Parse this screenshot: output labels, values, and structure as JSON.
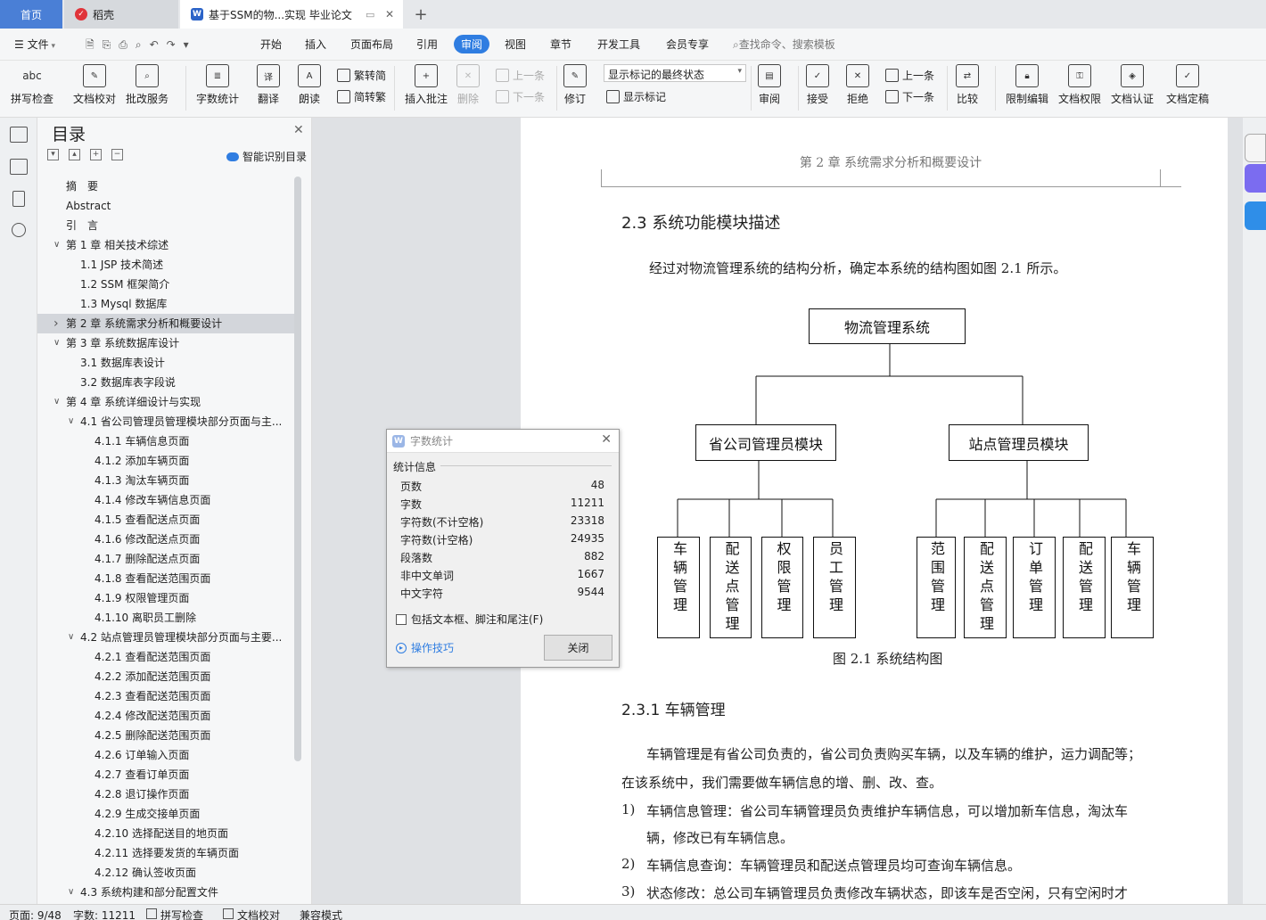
{
  "tabs": {
    "home": "首页",
    "daoke": "稻壳",
    "doc": "基于SSM的物...实现 毕业论文",
    "new_tab": "+"
  },
  "menu": {
    "file": "文件",
    "items": [
      "开始",
      "插入",
      "页面布局",
      "引用",
      "审阅",
      "视图",
      "章节",
      "开发工具",
      "会员专享"
    ],
    "search": "查找命令、搜索模板"
  },
  "ribbon": {
    "spellcheck": "拼写检查",
    "doc_proof": "文档校对",
    "batch_service": "批改服务",
    "wordcount": "字数统计",
    "translate": "翻译",
    "read_aloud": "朗读",
    "trad": "繁转简",
    "simp": "简转繁",
    "insert_comment": "插入批注",
    "delete": "删除",
    "prev_comment": "上一条",
    "next_comment": "下一条",
    "track": "修订",
    "markup_select": "显示标记的最终状态",
    "show_markup": "显示标记",
    "review": "审阅",
    "accept": "接受",
    "reject": "拒绝",
    "prev": "上一条",
    "next": "下一条",
    "compare": "比较",
    "restrict": "限制编辑",
    "permission": "文档权限",
    "certify": "文档认证",
    "finalize": "文档定稿"
  },
  "toc": {
    "title": "目录",
    "smart": "智能识别目录",
    "items": [
      {
        "text": "摘　要",
        "level": 0,
        "arrow": ""
      },
      {
        "text": "Abstract",
        "level": 0,
        "arrow": ""
      },
      {
        "text": "引　言",
        "level": 0,
        "arrow": ""
      },
      {
        "text": "第 1 章  相关技术综述",
        "level": 0,
        "arrow": "down"
      },
      {
        "text": "1.1 JSP 技术简述",
        "level": 1,
        "arrow": ""
      },
      {
        "text": "1.2 SSM 框架简介",
        "level": 1,
        "arrow": ""
      },
      {
        "text": "1.3 Mysql 数据库",
        "level": 1,
        "arrow": ""
      },
      {
        "text": "第 2 章  系统需求分析和概要设计",
        "level": 0,
        "arrow": "right",
        "selected": true
      },
      {
        "text": "第 3 章  系统数据库设计",
        "level": 0,
        "arrow": "down"
      },
      {
        "text": "3.1  数据库表设计",
        "level": 1,
        "arrow": ""
      },
      {
        "text": "3.2  数据库表字段说",
        "level": 1,
        "arrow": ""
      },
      {
        "text": "第 4 章  系统详细设计与实现",
        "level": 0,
        "arrow": "down"
      },
      {
        "text": "4.1  省公司管理员管理模块部分页面与主...",
        "level": 1,
        "arrow": "down"
      },
      {
        "text": "4.1.1 车辆信息页面",
        "level": 2,
        "arrow": ""
      },
      {
        "text": "4.1.2 添加车辆页面",
        "level": 2,
        "arrow": ""
      },
      {
        "text": "4.1.3 淘汰车辆页面",
        "level": 2,
        "arrow": ""
      },
      {
        "text": "4.1.4 修改车辆信息页面",
        "level": 2,
        "arrow": ""
      },
      {
        "text": "4.1.5 查看配送点页面",
        "level": 2,
        "arrow": ""
      },
      {
        "text": "4.1.6 修改配送点页面",
        "level": 2,
        "arrow": ""
      },
      {
        "text": "4.1.7 删除配送点页面",
        "level": 2,
        "arrow": ""
      },
      {
        "text": "4.1.8 查看配送范围页面",
        "level": 2,
        "arrow": ""
      },
      {
        "text": "4.1.9 权限管理页面",
        "level": 2,
        "arrow": ""
      },
      {
        "text": "4.1.10 离职员工删除",
        "level": 2,
        "arrow": ""
      },
      {
        "text": "4.2 站点管理员管理模块部分页面与主要...",
        "level": 1,
        "arrow": "down"
      },
      {
        "text": "4.2.1 查看配送范围页面",
        "level": 2,
        "arrow": ""
      },
      {
        "text": "4.2.2 添加配送范围页面",
        "level": 2,
        "arrow": ""
      },
      {
        "text": "4.2.3 查看配送范围页面",
        "level": 2,
        "arrow": ""
      },
      {
        "text": "4.2.4 修改配送范围页面",
        "level": 2,
        "arrow": ""
      },
      {
        "text": "4.2.5 删除配送范围页面",
        "level": 2,
        "arrow": ""
      },
      {
        "text": "4.2.6 订单输入页面",
        "level": 2,
        "arrow": ""
      },
      {
        "text": "4.2.7 查看订单页面",
        "level": 2,
        "arrow": ""
      },
      {
        "text": "4.2.8 退订操作页面",
        "level": 2,
        "arrow": ""
      },
      {
        "text": "4.2.9 生成交接单页面",
        "level": 2,
        "arrow": ""
      },
      {
        "text": "4.2.10 选择配送目的地页面",
        "level": 2,
        "arrow": ""
      },
      {
        "text": "4.2.11 选择要发货的车辆页面",
        "level": 2,
        "arrow": ""
      },
      {
        "text": "4.2.12 确认签收页面",
        "level": 2,
        "arrow": ""
      },
      {
        "text": "4.3 系统构建和部分配置文件",
        "level": 1,
        "arrow": "down"
      }
    ]
  },
  "document": {
    "header": "第 2 章  系统需求分析和概要设计",
    "section_title": "2.3  系统功能模块描述",
    "intro": "经过对物流管理系统的结构分析，确定本系统的结构图如图 2.1 所示。",
    "diagram": {
      "root": "物流管理系统",
      "left_module": "省公司管理员模块",
      "right_module": "站点管理员模块",
      "left_children": [
        "车辆管理",
        "配送点管理",
        "权限管理",
        "员工管理"
      ],
      "right_children": [
        "范围管理",
        "配送点管理",
        "订单管理",
        "配送管理",
        "车辆管理"
      ],
      "caption": "图 2.1  系统结构图"
    },
    "subsection_title": "2.3.1 车辆管理",
    "para1_line1": "车辆管理是有省公司负责的，省公司负责购买车辆，以及车辆的维护，运力调配等；",
    "para1_line2": "在该系统中，我们需要做车辆信息的增、删、改、查。",
    "list": [
      {
        "num": "1)",
        "line1": "车辆信息管理：省公司车辆管理员负责维护车辆信息，可以增加新车信息，淘汰车",
        "line2": "辆，修改已有车辆信息。"
      },
      {
        "num": "2)",
        "line1": "车辆信息查询：车辆管理员和配送点管理员均可查询车辆信息。",
        "line2": ""
      },
      {
        "num": "3)",
        "line1": "状态修改：总公司车辆管理员负责修改车辆状态，即该车是否空闲，只有空闲时才",
        "line2": ""
      }
    ]
  },
  "dialog": {
    "title": "字数统计",
    "section": "统计信息",
    "rows": [
      {
        "label": "页数",
        "value": "48"
      },
      {
        "label": "字数",
        "value": "11211"
      },
      {
        "label": "字符数(不计空格)",
        "value": "23318"
      },
      {
        "label": "字符数(计空格)",
        "value": "24935"
      },
      {
        "label": "段落数",
        "value": "882"
      },
      {
        "label": "非中文单词",
        "value": "1667"
      },
      {
        "label": "中文字符",
        "value": "9544"
      }
    ],
    "checkbox": "包括文本框、脚注和尾注(F)",
    "tips": "操作技巧",
    "close": "关闭"
  },
  "status": {
    "page": "页面: 9/48",
    "words": "字数: 11211",
    "spell": "拼写检查",
    "proof": "文档校对",
    "compat": "兼容模式"
  },
  "colors": {
    "accent": "#2f7de1",
    "tab_home": "#4a7fd6",
    "daoke": "#e0343a",
    "doc_icon": "#2b63c8"
  }
}
